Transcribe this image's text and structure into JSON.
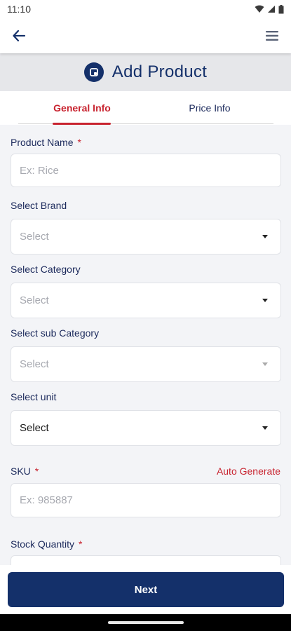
{
  "status_bar": {
    "time": "11:10"
  },
  "header": {
    "back_icon": "arrow-left-icon",
    "menu_icon": "hamburger-menu-icon",
    "title": "Add Product"
  },
  "tabs": [
    {
      "label": "General Info",
      "active": true
    },
    {
      "label": "Price Info",
      "active": false
    }
  ],
  "form": {
    "product_name": {
      "label": "Product Name",
      "required": "*",
      "placeholder": "Ex: Rice"
    },
    "brand": {
      "label": "Select Brand",
      "value": "Select"
    },
    "category": {
      "label": "Select Category",
      "value": "Select"
    },
    "sub_category": {
      "label": "Select sub Category",
      "value": "Select"
    },
    "unit": {
      "label": "Select unit",
      "value": "Select"
    },
    "sku": {
      "label": "SKU",
      "required": "*",
      "auto_generate": "Auto Generate",
      "placeholder": "Ex: 985887"
    },
    "stock_quantity": {
      "label": "Stock Quantity",
      "required": "*"
    }
  },
  "footer": {
    "next_label": "Next"
  },
  "colors": {
    "primary": "#14306a",
    "accent": "#c8232f",
    "band": "#e6e7ea"
  }
}
